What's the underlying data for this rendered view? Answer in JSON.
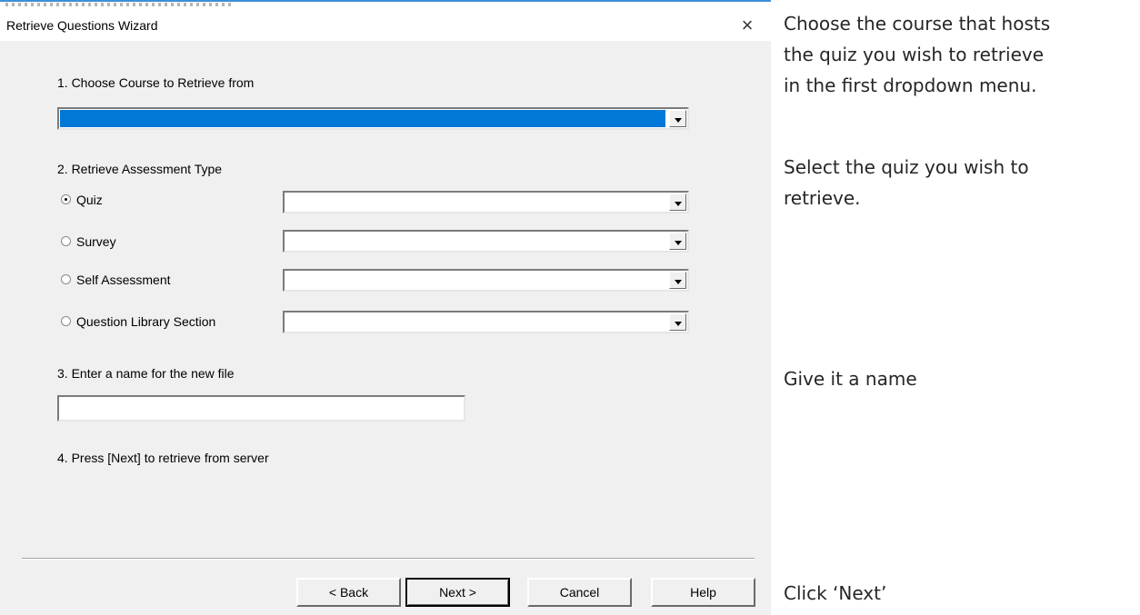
{
  "dialog": {
    "title": "Retrieve Questions Wizard",
    "close_glyph": "×",
    "step1": {
      "label": "1. Choose Course to Retrieve from",
      "selected_value": ""
    },
    "step2": {
      "label": "2. Retrieve Assessment Type",
      "options": [
        {
          "label": "Quiz",
          "checked": true,
          "value": ""
        },
        {
          "label": "Survey",
          "checked": false,
          "value": ""
        },
        {
          "label": "Self Assessment",
          "checked": false,
          "value": ""
        },
        {
          "label": "Question Library Section",
          "checked": false,
          "value": ""
        }
      ]
    },
    "step3": {
      "label": "3. Enter a name for the new file",
      "value": ""
    },
    "step4": {
      "label": "4. Press [Next] to retrieve from server"
    },
    "buttons": {
      "back": "< Back",
      "next": "Next >",
      "cancel": "Cancel",
      "help": "Help"
    },
    "colors": {
      "selection": "#0078d7",
      "window_bg": "#f0f0f0"
    }
  },
  "instructions": {
    "course": [
      "Choose the course that hosts",
      "the quiz you wish to retrieve",
      "in the first dropdown menu."
    ],
    "quiz": [
      "Select the quiz you wish to",
      "retrieve."
    ],
    "name": "Give it a name",
    "next": "Click ‘Next’"
  }
}
